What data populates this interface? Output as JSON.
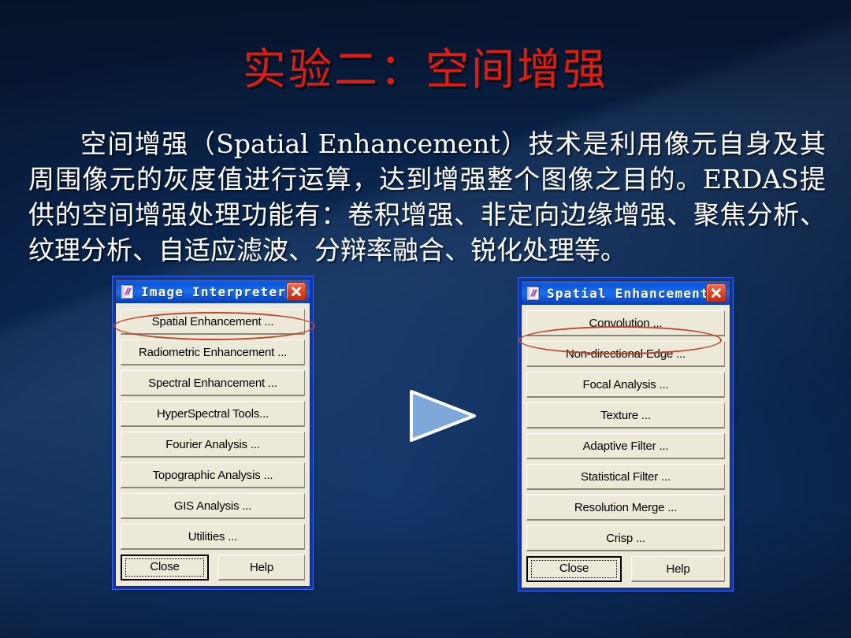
{
  "slide": {
    "title": "实验二：空间增强",
    "body": "空间增强（Spatial Enhancement）技术是利用像元自身及其周围像元的灰度值进行运算，达到增强整个图像之目的。ERDAS提供的空间增强处理功能有：卷积增强、非定向边缘增强、聚焦分析、纹理分析、自适应滤波、分辩率融合、锐化处理等。",
    "colors": {
      "background": "#0d2c5a",
      "title_text": "#e01b10",
      "body_text": "#ffffff",
      "annotation_oval": "#c1442a",
      "arrow_fill": "#7da7d9",
      "arrow_stroke": "#ffffff",
      "titlebar_blue": "#1563e8",
      "dialog_face": "#ece9d8",
      "close_button_red": "#e24a2a"
    }
  },
  "arrow": {
    "icon": "triangle-right-icon"
  },
  "dialog_left": {
    "title": "Image Interpreter",
    "icon": "image-interpreter-icon",
    "close_icon": "close-x-icon",
    "buttons": [
      "Spatial Enhancement ...",
      "Radiometric Enhancement ...",
      "Spectral Enhancement ...",
      "HyperSpectral Tools...",
      "Fourier Analysis ...",
      "Topographic Analysis ...",
      "GIS Analysis ...",
      "Utilities ..."
    ],
    "footer": {
      "close_label": "Close",
      "help_label": "Help"
    },
    "highlighted_button": "Spatial Enhancement ..."
  },
  "dialog_right": {
    "title": "Spatial Enhancement",
    "icon": "spatial-enhancement-icon",
    "close_icon": "close-x-icon",
    "buttons": [
      "Convolution ...",
      "Non-directional Edge ...",
      "Focal Analysis ...",
      "Texture ...",
      "Adaptive Filter ...",
      "Statistical Filter ...",
      "Resolution Merge ...",
      "Crisp ..."
    ],
    "footer": {
      "close_label": "Close",
      "help_label": "Help"
    },
    "highlighted_button": "Convolution ..."
  }
}
